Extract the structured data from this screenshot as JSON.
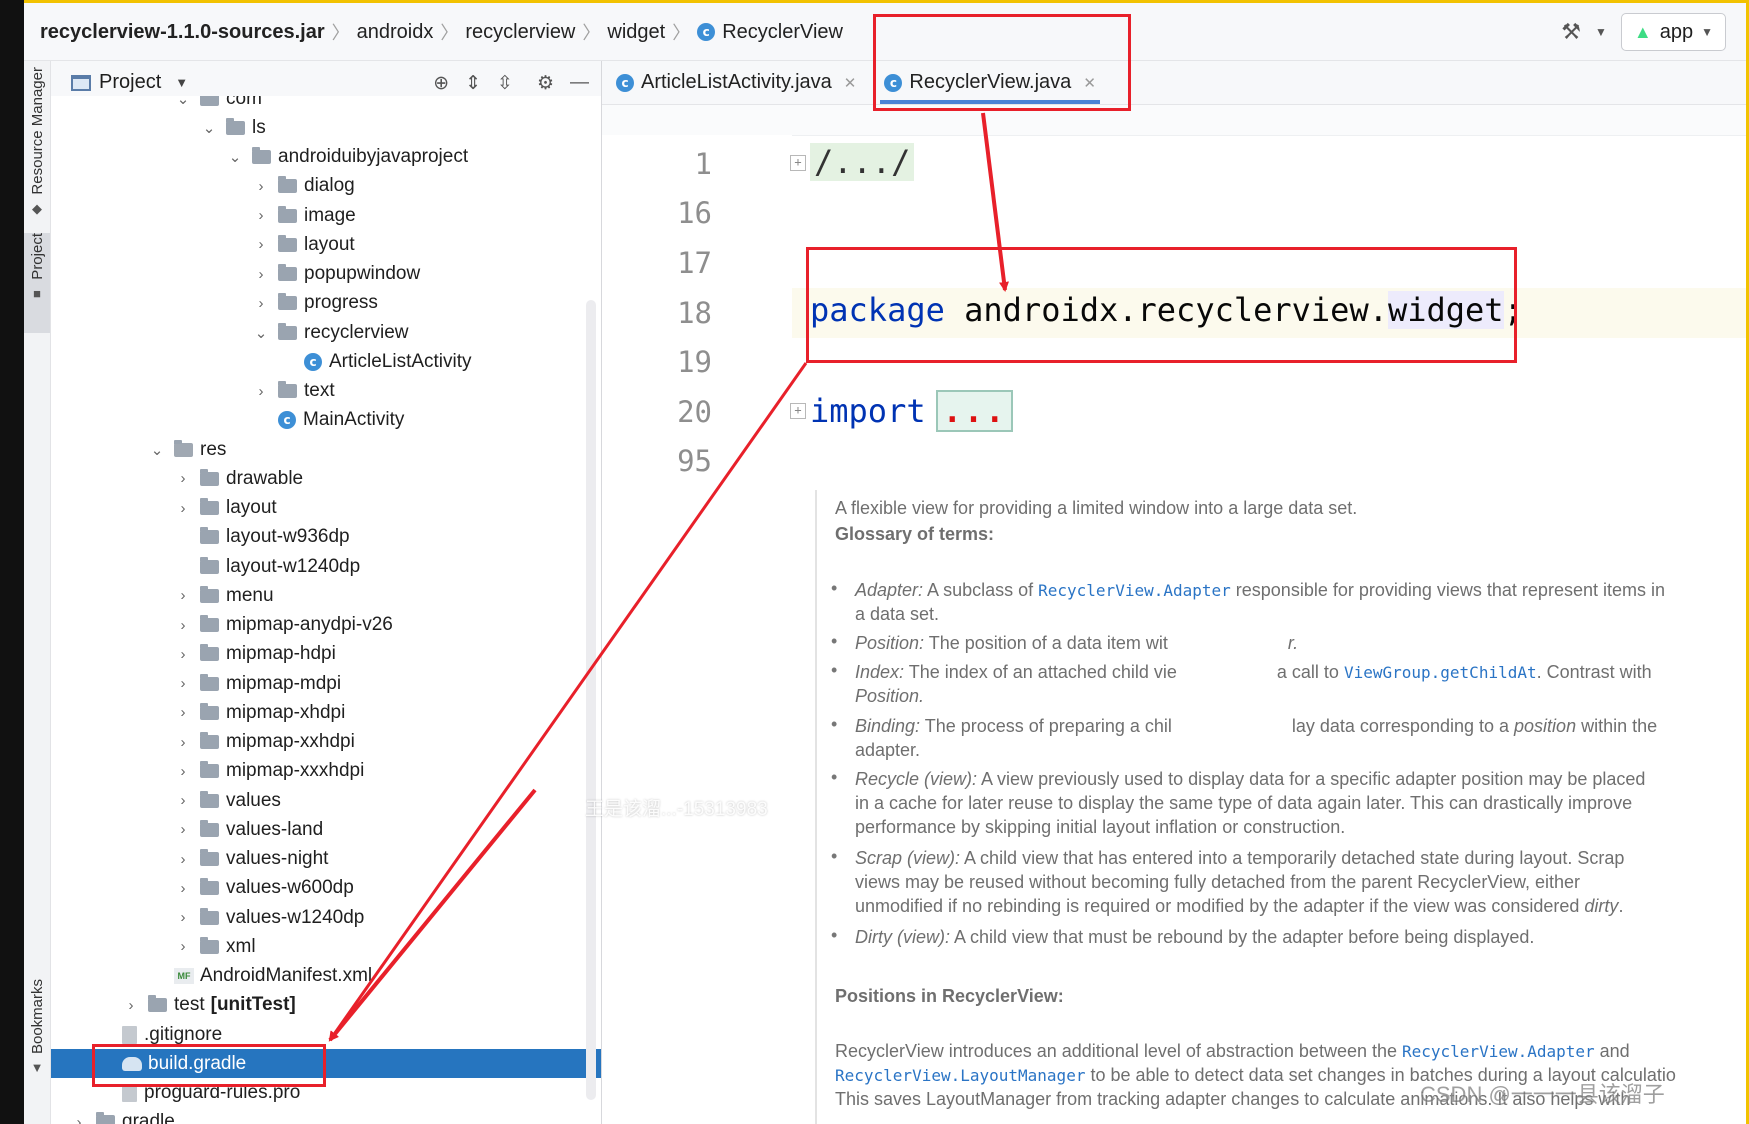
{
  "breadcrumb": {
    "items": [
      "recyclerview-1.1.0-sources.jar",
      "androidx",
      "recyclerview",
      "widget",
      "RecyclerView"
    ]
  },
  "run_config": {
    "label": "app"
  },
  "tool_strip": {
    "resource_manager": "Resource Manager",
    "project": "Project",
    "bookmarks": "Bookmarks"
  },
  "project_panel": {
    "title": "Project",
    "tree": [
      {
        "label": "com",
        "indent": 2,
        "chevron": "down",
        "icon": "folder"
      },
      {
        "label": "ls",
        "indent": 3,
        "chevron": "down",
        "icon": "folder"
      },
      {
        "label": "androiduibyjavaproject",
        "indent": 4,
        "chevron": "down",
        "icon": "folder"
      },
      {
        "label": "dialog",
        "indent": 5,
        "chevron": "right",
        "icon": "folder"
      },
      {
        "label": "image",
        "indent": 5,
        "chevron": "right",
        "icon": "folder"
      },
      {
        "label": "layout",
        "indent": 5,
        "chevron": "right",
        "icon": "folder"
      },
      {
        "label": "popupwindow",
        "indent": 5,
        "chevron": "right",
        "icon": "folder"
      },
      {
        "label": "progress",
        "indent": 5,
        "chevron": "right",
        "icon": "folder"
      },
      {
        "label": "recyclerview",
        "indent": 5,
        "chevron": "down",
        "icon": "folder"
      },
      {
        "label": "ArticleListActivity",
        "indent": 6,
        "chevron": "",
        "icon": "class"
      },
      {
        "label": "text",
        "indent": 5,
        "chevron": "right",
        "icon": "folder"
      },
      {
        "label": "MainActivity",
        "indent": 5,
        "chevron": "",
        "icon": "class"
      },
      {
        "label": "res",
        "indent": 1,
        "chevron": "down",
        "icon": "res"
      },
      {
        "label": "drawable",
        "indent": 2,
        "chevron": "right",
        "icon": "folder"
      },
      {
        "label": "layout",
        "indent": 2,
        "chevron": "right",
        "icon": "folder"
      },
      {
        "label": "layout-w936dp",
        "indent": 2,
        "chevron": "",
        "icon": "folder"
      },
      {
        "label": "layout-w1240dp",
        "indent": 2,
        "chevron": "",
        "icon": "folder"
      },
      {
        "label": "menu",
        "indent": 2,
        "chevron": "right",
        "icon": "folder"
      },
      {
        "label": "mipmap-anydpi-v26",
        "indent": 2,
        "chevron": "right",
        "icon": "folder"
      },
      {
        "label": "mipmap-hdpi",
        "indent": 2,
        "chevron": "right",
        "icon": "folder"
      },
      {
        "label": "mipmap-mdpi",
        "indent": 2,
        "chevron": "right",
        "icon": "folder"
      },
      {
        "label": "mipmap-xhdpi",
        "indent": 2,
        "chevron": "right",
        "icon": "folder"
      },
      {
        "label": "mipmap-xxhdpi",
        "indent": 2,
        "chevron": "right",
        "icon": "folder"
      },
      {
        "label": "mipmap-xxxhdpi",
        "indent": 2,
        "chevron": "right",
        "icon": "folder"
      },
      {
        "label": "values",
        "indent": 2,
        "chevron": "right",
        "icon": "folder"
      },
      {
        "label": "values-land",
        "indent": 2,
        "chevron": "right",
        "icon": "folder"
      },
      {
        "label": "values-night",
        "indent": 2,
        "chevron": "right",
        "icon": "folder"
      },
      {
        "label": "values-w600dp",
        "indent": 2,
        "chevron": "right",
        "icon": "folder"
      },
      {
        "label": "values-w1240dp",
        "indent": 2,
        "chevron": "right",
        "icon": "folder"
      },
      {
        "label": "xml",
        "indent": 2,
        "chevron": "right",
        "icon": "folder"
      },
      {
        "label": "AndroidManifest.xml",
        "indent": 1,
        "chevron": "",
        "icon": "manifest"
      },
      {
        "label": "test",
        "bold_suffix": "[unitTest]",
        "indent": 0,
        "chevron": "right",
        "icon": "folder"
      },
      {
        "label": ".gitignore",
        "indent": -1,
        "chevron": "",
        "icon": "file"
      },
      {
        "label": "build.gradle",
        "indent": -1,
        "chevron": "",
        "icon": "gradle",
        "selected": true
      },
      {
        "label": "proguard-rules.pro",
        "indent": -1,
        "chevron": "",
        "icon": "file"
      },
      {
        "label": "gradle",
        "indent": -2,
        "chevron": "right",
        "icon": "folder"
      }
    ]
  },
  "editor": {
    "tabs": [
      {
        "label": "ArticleListActivity.java",
        "active": false
      },
      {
        "label": "RecyclerView.java",
        "active": true
      }
    ],
    "lines": [
      {
        "num": "1",
        "fold": "/.../"
      },
      {
        "num": "16"
      },
      {
        "num": "17"
      },
      {
        "num": "18",
        "keyword": "package",
        "pkg_prefix": "androidx.recyclerview.",
        "pkg_highlight": "widget",
        "pkg_end": ";"
      },
      {
        "num": "19"
      },
      {
        "num": "20",
        "keyword": "import",
        "folded": "..."
      },
      {
        "num": "95"
      }
    ]
  },
  "doc": {
    "intro": "A flexible view for providing a limited window into a large data set.",
    "glossary_title": "Glossary of terms:",
    "bullets": [
      [
        "Adapter:",
        " A subclass of ",
        "RecyclerView.Adapter",
        " responsible for providing views that represent items in"
      ],
      [
        "a data set."
      ],
      [
        "Position:",
        " The position of a data item wit",
        "r."
      ],
      [
        "Index:",
        " The index of an attached child vie",
        "a call to ",
        "ViewGroup.getChildAt",
        ". Contrast with"
      ],
      [
        "Position."
      ],
      [
        "Binding:",
        " The process of preparing a chil",
        "lay data corresponding to a ",
        "position",
        " within the"
      ],
      [
        "adapter."
      ],
      [
        "Recycle (view):",
        " A view previously used to display data for a specific adapter position may be placed"
      ],
      [
        "in a cache for later reuse to display the same type of data again later. This can drastically improve"
      ],
      [
        "performance by skipping initial layout inflation or construction."
      ],
      [
        "Scrap (view):",
        " A child view that has entered into a temporarily detached state during layout. Scrap"
      ],
      [
        "views may be reused without becoming fully detached from the parent RecyclerView, either"
      ],
      [
        "unmodified if no rebinding is required or modified by the adapter if the view was considered ",
        "dirty",
        "."
      ],
      [
        "Dirty (view):",
        " A child view that must be rebound by the adapter before being displayed."
      ]
    ],
    "positions_title": "Positions in RecyclerView:",
    "para": [
      [
        "RecyclerView introduces an additional level of abstraction between the ",
        "RecyclerView.Adapter",
        " and"
      ],
      [
        "RecyclerView.LayoutManager",
        " to be able to detect data set changes in batches during a layout calculatio"
      ],
      [
        "This saves LayoutManager from tracking adapter changes to calculate animations. It also helps with"
      ]
    ]
  },
  "watermarks": {
    "center": "王是该溜...-15313983",
    "corner": "CSDN @一一一县该溜子"
  },
  "colors": {
    "annotation_red": "#e8202a",
    "selection_blue": "#2675bf",
    "keyword_blue": "#0033b3"
  }
}
